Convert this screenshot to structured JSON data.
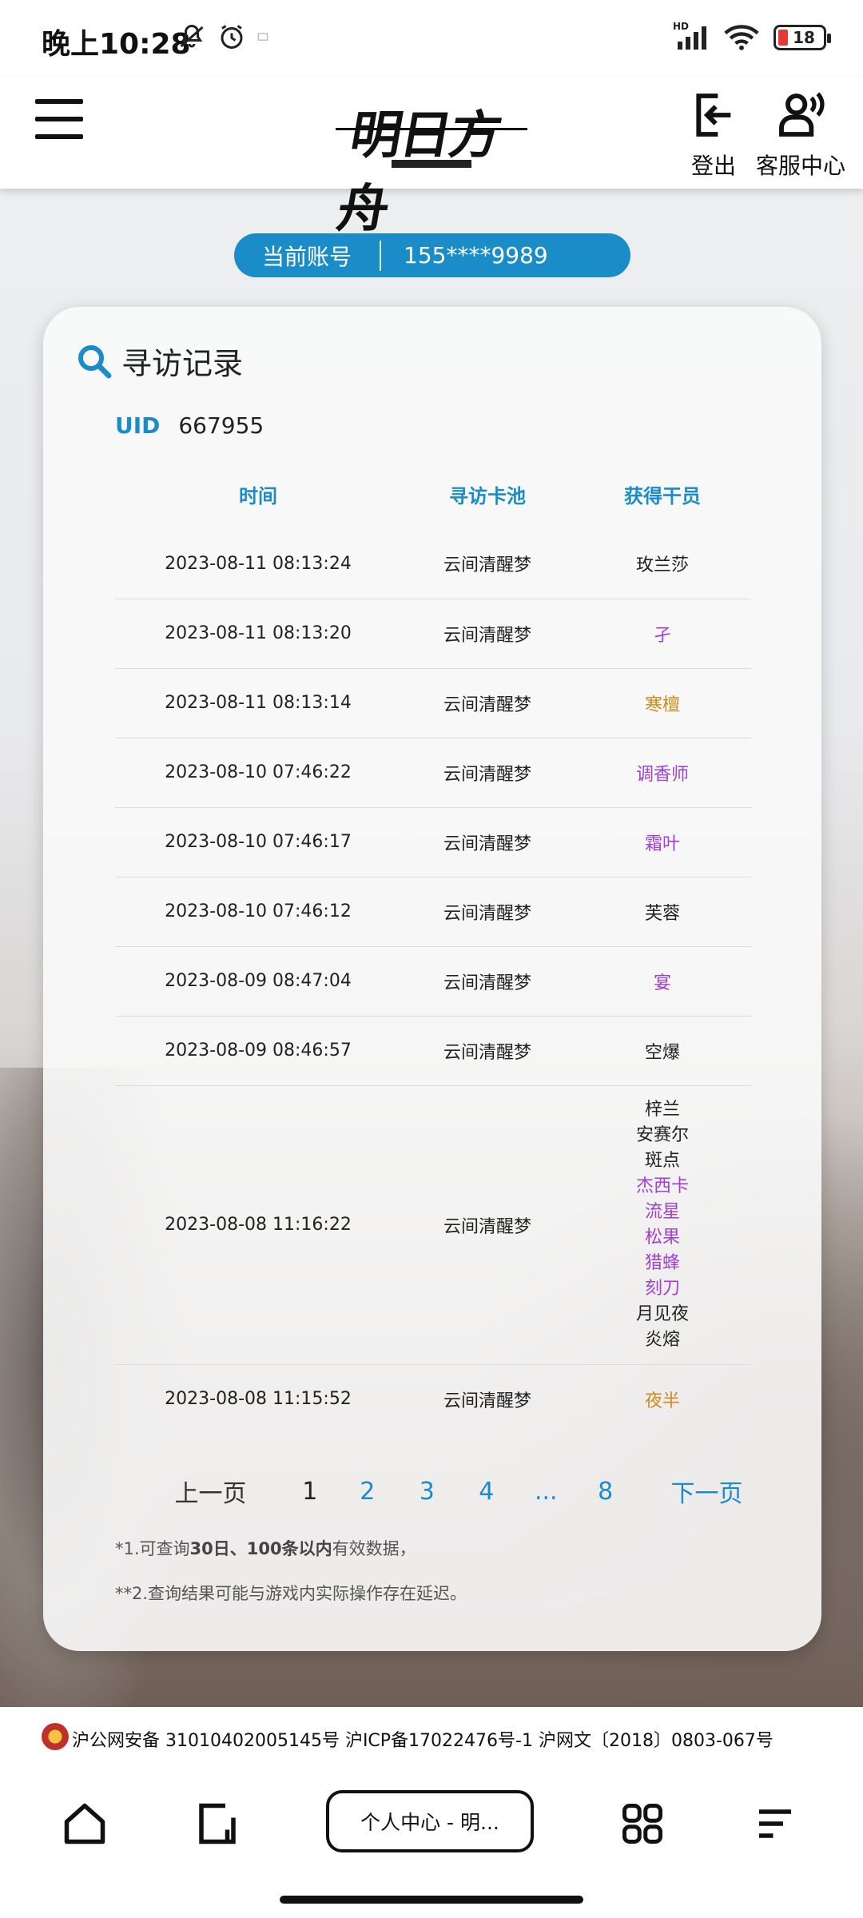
{
  "status_bar": {
    "time": "晚上10:28",
    "network": "HD",
    "battery": "18"
  },
  "header": {
    "logo_text": "明日方舟",
    "logout_label": "登出",
    "support_label": "客服中心"
  },
  "account": {
    "label": "当前账号",
    "value": "155****9989"
  },
  "records": {
    "title": "寻访记录",
    "uid_label": "UID",
    "uid_value": "667955",
    "columns": [
      "时间",
      "寻访卡池",
      "获得干员"
    ],
    "rows": [
      {
        "time": "2023-08-11 08:13:24",
        "pool": "云间清醒梦",
        "operators": [
          {
            "name": "玫兰莎",
            "rarity": "normal"
          }
        ]
      },
      {
        "time": "2023-08-11 08:13:20",
        "pool": "云间清醒梦",
        "operators": [
          {
            "name": "孑",
            "rarity": "purple"
          }
        ]
      },
      {
        "time": "2023-08-11 08:13:14",
        "pool": "云间清醒梦",
        "operators": [
          {
            "name": "寒檀",
            "rarity": "gold"
          }
        ]
      },
      {
        "time": "2023-08-10 07:46:22",
        "pool": "云间清醒梦",
        "operators": [
          {
            "name": "调香师",
            "rarity": "purple"
          }
        ]
      },
      {
        "time": "2023-08-10 07:46:17",
        "pool": "云间清醒梦",
        "operators": [
          {
            "name": "霜叶",
            "rarity": "purple"
          }
        ]
      },
      {
        "time": "2023-08-10 07:46:12",
        "pool": "云间清醒梦",
        "operators": [
          {
            "name": "芙蓉",
            "rarity": "normal"
          }
        ]
      },
      {
        "time": "2023-08-09 08:47:04",
        "pool": "云间清醒梦",
        "operators": [
          {
            "name": "宴",
            "rarity": "purple"
          }
        ]
      },
      {
        "time": "2023-08-09 08:46:57",
        "pool": "云间清醒梦",
        "operators": [
          {
            "name": "空爆",
            "rarity": "normal"
          }
        ]
      },
      {
        "time": "2023-08-08 11:16:22",
        "pool": "云间清醒梦",
        "operators": [
          {
            "name": "梓兰",
            "rarity": "normal"
          },
          {
            "name": "安赛尔",
            "rarity": "normal"
          },
          {
            "name": "斑点",
            "rarity": "normal"
          },
          {
            "name": "杰西卡",
            "rarity": "purple"
          },
          {
            "name": "流星",
            "rarity": "purple"
          },
          {
            "name": "松果",
            "rarity": "purple"
          },
          {
            "name": "猎蜂",
            "rarity": "purple"
          },
          {
            "name": "刻刀",
            "rarity": "purple"
          },
          {
            "name": "月见夜",
            "rarity": "normal"
          },
          {
            "name": "炎熔",
            "rarity": "normal"
          }
        ]
      },
      {
        "time": "2023-08-08 11:15:52",
        "pool": "云间清醒梦",
        "operators": [
          {
            "name": "夜半",
            "rarity": "gold"
          }
        ]
      }
    ]
  },
  "pagination": {
    "prev": "上一页",
    "current": "1",
    "pages": [
      "2",
      "3",
      "4",
      "...",
      "8"
    ],
    "next": "下一页"
  },
  "notes": {
    "note1_prefix": "*1.可查询",
    "note1_bold": "30日、100条以内",
    "note1_suffix": "有效数据，",
    "note2": "**2.查询结果可能与游戏内实际操作存在延迟。"
  },
  "footer": {
    "license": "沪公网安备 31010402005145号  沪ICP备17022476号-1  沪网文〔2018〕0803-067号"
  },
  "navbar": {
    "tab_label": "个人中心 - 明..."
  },
  "colors": {
    "accent": "#1a8cc8",
    "rarity_purple": "#a040d0",
    "rarity_gold": "#d08a1a",
    "rarity_normal": "#222222"
  }
}
